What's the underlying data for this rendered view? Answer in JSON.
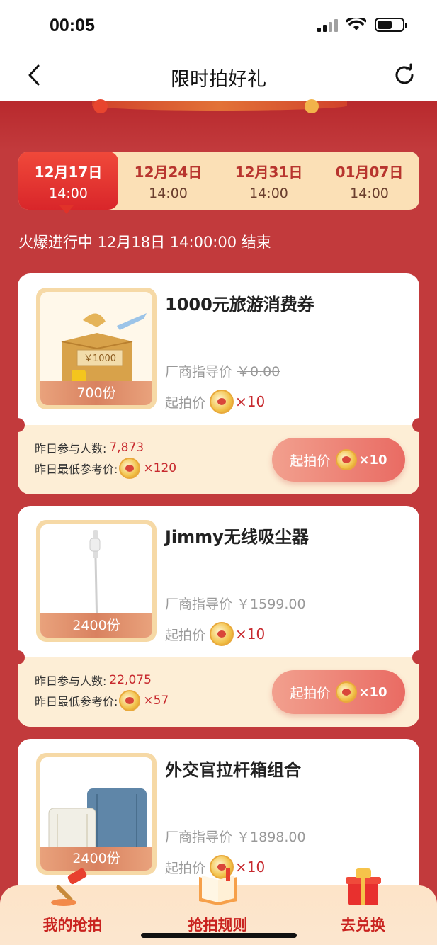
{
  "status": {
    "time": "00:05"
  },
  "nav": {
    "title": "限时拍好礼"
  },
  "tabs": [
    {
      "date": "12月17日",
      "time": "14:00"
    },
    {
      "date": "12月24日",
      "time": "14:00"
    },
    {
      "date": "12月31日",
      "time": "14:00"
    },
    {
      "date": "01月07日",
      "time": "14:00"
    }
  ],
  "status_line": "火爆进行中 12月18日 14:00:00 结束",
  "products": [
    {
      "title": "1000元旅游消费券",
      "quantity": "700份",
      "msrp_label": "厂商指导价",
      "msrp": "￥0.00",
      "start_label": "起拍价",
      "start_mult": "×10",
      "participants_label": "昨日参与人数:",
      "participants": "7,873",
      "lowest_label": "昨日最低参考价:",
      "lowest_mult": "×120",
      "btn_label": "起拍价",
      "btn_mult": "×10",
      "voucher_text": "￥1000"
    },
    {
      "title": "Jimmy无线吸尘器",
      "quantity": "2400份",
      "msrp_label": "厂商指导价",
      "msrp": "￥1599.00",
      "start_label": "起拍价",
      "start_mult": "×10",
      "participants_label": "昨日参与人数:",
      "participants": "22,075",
      "lowest_label": "昨日最低参考价:",
      "lowest_mult": "×57",
      "btn_label": "起拍价",
      "btn_mult": "×10"
    },
    {
      "title": "外交官拉杆箱组合",
      "quantity": "2400份",
      "msrp_label": "厂商指导价",
      "msrp": "￥1898.00",
      "start_label": "起拍价",
      "start_mult": "×10"
    }
  ],
  "bottom_nav": [
    {
      "label": "我的抢拍",
      "icon": "gavel-icon"
    },
    {
      "label": "抢拍规则",
      "icon": "rulebook-icon"
    },
    {
      "label": "去兑换",
      "icon": "gift-box-icon"
    }
  ],
  "colors": {
    "primary_red": "#c23a3c",
    "accent_red": "#c7292e",
    "cream": "#fdeed6",
    "tab_bg": "#fbe0b6"
  }
}
